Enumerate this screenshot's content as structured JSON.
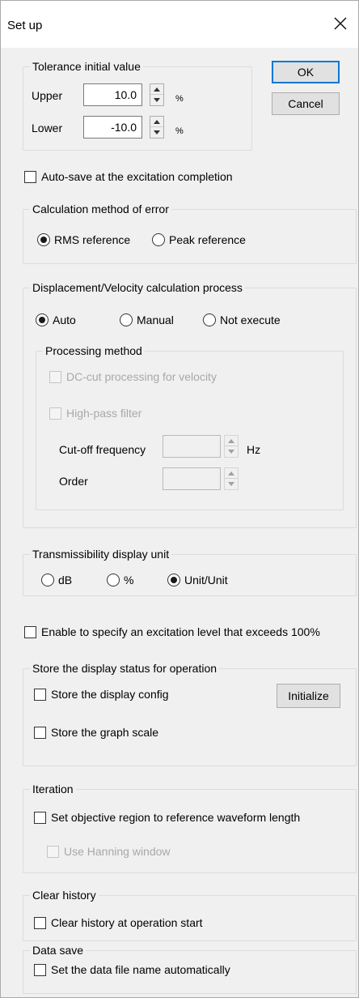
{
  "window": {
    "title": "Set up"
  },
  "buttons": {
    "ok": "OK",
    "cancel": "Cancel",
    "initialize": "Initialize"
  },
  "tolerance": {
    "group_title": "Tolerance initial value",
    "upper_label": "Upper",
    "upper_value": "10.0",
    "lower_label": "Lower",
    "lower_value": "-10.0",
    "unit": "%"
  },
  "autosave": {
    "label": "Auto-save at the excitation completion",
    "checked": false
  },
  "calc_error": {
    "group_title": "Calculation method of error",
    "options": [
      "RMS reference",
      "Peak reference"
    ],
    "selected": "RMS reference"
  },
  "displacement": {
    "group_title": "Displacement/Velocity calculation process",
    "options": [
      "Auto",
      "Manual",
      "Not execute"
    ],
    "selected": "Auto",
    "processing": {
      "group_title": "Processing method",
      "dc_cut_label": "DC-cut processing for velocity",
      "highpass_label": "High-pass filter",
      "cutoff_label": "Cut-off frequency",
      "cutoff_unit": "Hz",
      "order_label": "Order"
    }
  },
  "transmissibility": {
    "group_title": "Transmissibility display unit",
    "options": [
      "dB",
      "%",
      "Unit/Unit"
    ],
    "selected": "Unit/Unit"
  },
  "exceed": {
    "label": "Enable to specify an excitation level that exceeds 100%"
  },
  "store_display": {
    "group_title": "Store the display status for operation",
    "config_label": "Store the display config",
    "scale_label": "Store the graph scale"
  },
  "iteration": {
    "group_title": "Iteration",
    "objective_label": "Set objective region to reference waveform length",
    "hanning_label": "Use Hanning window"
  },
  "clear_history": {
    "group_title": "Clear history",
    "label": "Clear history at operation start"
  },
  "data_save": {
    "group_title": "Data save",
    "label": "Set the data file name automatically"
  }
}
